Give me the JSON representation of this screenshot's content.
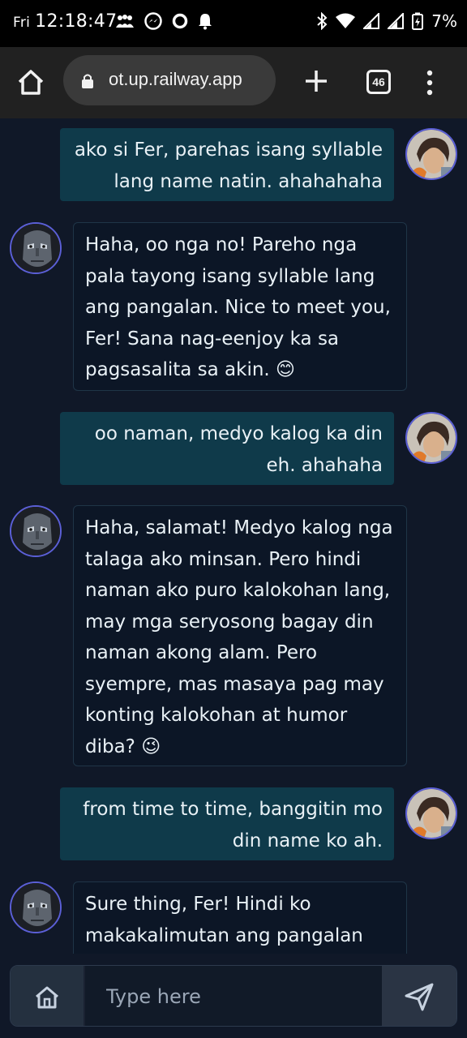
{
  "status_bar": {
    "day": "Fri",
    "time": "12:18:47",
    "battery": "7%"
  },
  "browser": {
    "url": "ot.up.railway.app",
    "tab_count": "46"
  },
  "messages": [
    {
      "role": "user",
      "text": "ako si Fer, parehas isang syllable\nlang name natin. ahahahaha"
    },
    {
      "role": "bot",
      "text": "Haha, oo nga no! Pareho nga\npala tayong isang syllable lang\nang pangalan. Nice to meet you,\nFer! Sana nag-eenjoy ka sa\npagsasalita sa akin. 😊"
    },
    {
      "role": "user",
      "text": "oo naman, medyo kalog ka din\neh. ahahaha"
    },
    {
      "role": "bot",
      "text": "Haha, salamat! Medyo kalog nga\ntalaga ako minsan. Pero hindi\nnaman ako puro kalokohan lang,\nmay mga seryosong bagay din\nnaman akong alam. Pero\nsyempre, mas masaya pag may\nkonting kalokohan at humor\ndiba? 😉"
    },
    {
      "role": "user",
      "text": "from time to time, banggitin mo\ndin name ko ah."
    },
    {
      "role": "bot",
      "text": "Sure thing, Fer! Hindi ko\nmakakalimutan ang pangalan"
    }
  ],
  "input": {
    "placeholder": "Type here"
  },
  "colors": {
    "background": "#101828",
    "user_bubble": "#0f3a4a",
    "bot_bubble": "#0c1626",
    "avatar_border": "#5b5fd6"
  }
}
